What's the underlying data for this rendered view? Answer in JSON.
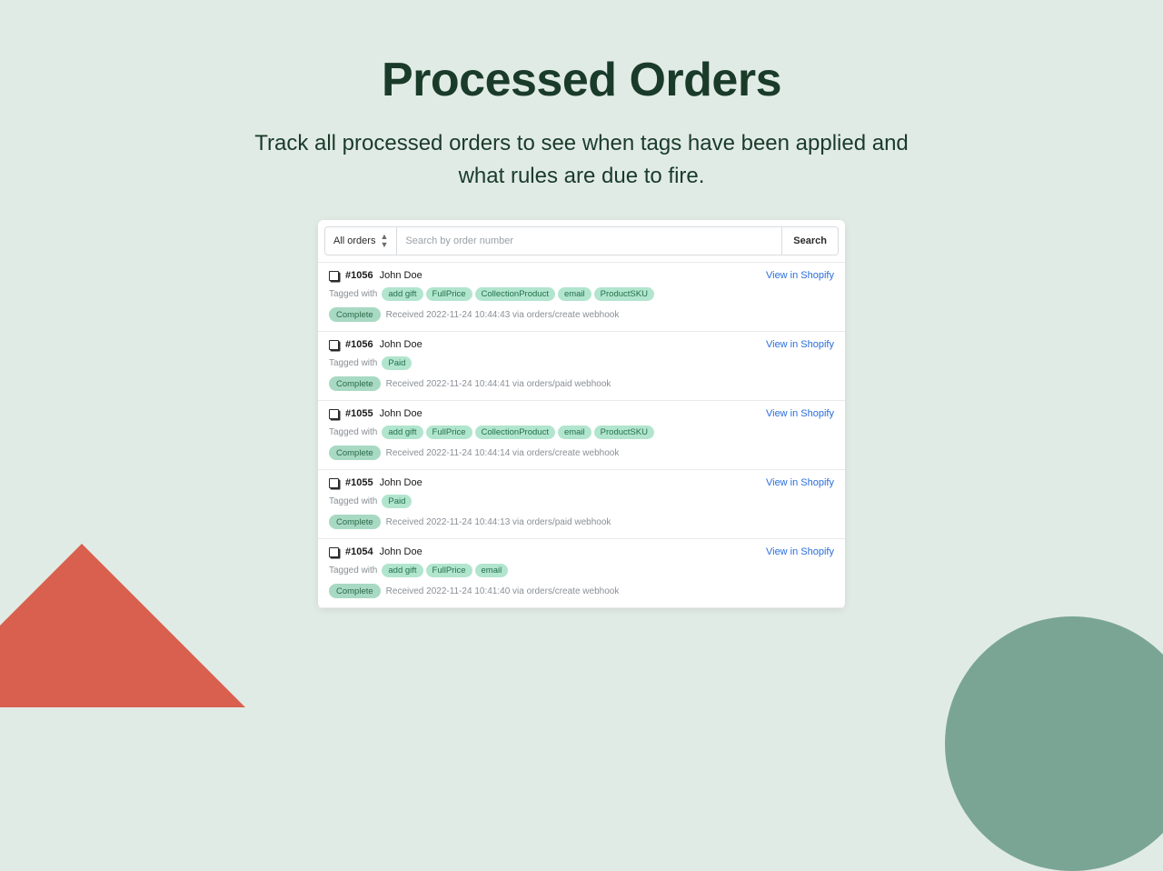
{
  "hero": {
    "title": "Processed Orders",
    "subtitle": "Track all processed orders to see when tags have been applied and what rules are due to fire."
  },
  "panel": {
    "filter_label": "All orders",
    "search_placeholder": "Search by order number",
    "search_button": "Search",
    "tagged_with_label": "Tagged with",
    "view_link_label": "View in Shopify"
  },
  "orders": [
    {
      "number": "#1056",
      "name": "John Doe",
      "tags": [
        "add gift",
        "FullPrice",
        "CollectionProduct",
        "email",
        "ProductSKU"
      ],
      "status": "Complete",
      "received": "Received 2022-11-24 10:44:43 via orders/create webhook"
    },
    {
      "number": "#1056",
      "name": "John Doe",
      "tags": [
        "Paid"
      ],
      "status": "Complete",
      "received": "Received 2022-11-24 10:44:41 via orders/paid webhook"
    },
    {
      "number": "#1055",
      "name": "John Doe",
      "tags": [
        "add gift",
        "FullPrice",
        "CollectionProduct",
        "email",
        "ProductSKU"
      ],
      "status": "Complete",
      "received": "Received 2022-11-24 10:44:14 via orders/create webhook"
    },
    {
      "number": "#1055",
      "name": "John Doe",
      "tags": [
        "Paid"
      ],
      "status": "Complete",
      "received": "Received 2022-11-24 10:44:13 via orders/paid webhook"
    },
    {
      "number": "#1054",
      "name": "John Doe",
      "tags": [
        "add gift",
        "FullPrice",
        "email"
      ],
      "status": "Complete",
      "received": "Received 2022-11-24 10:41:40 via orders/create webhook"
    }
  ]
}
